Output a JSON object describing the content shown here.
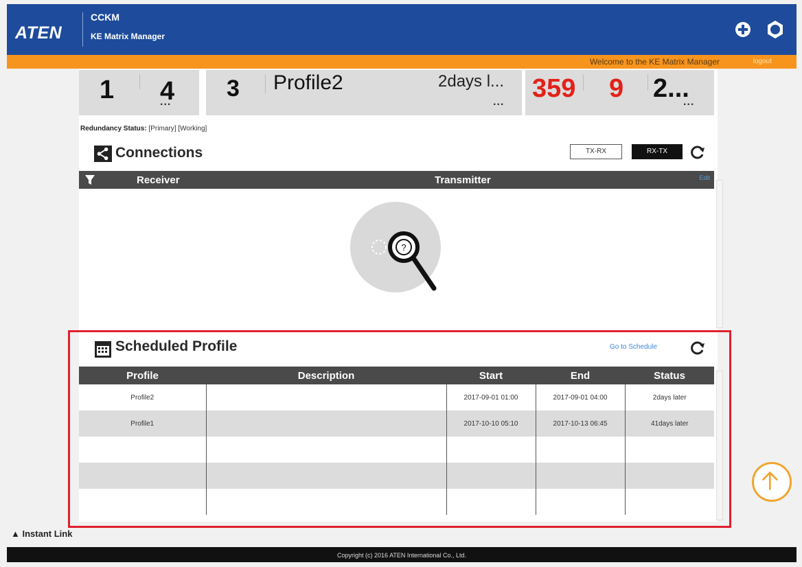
{
  "header": {
    "logo": "ATEN",
    "app_name": "CCKM",
    "app_subtitle": "KE Matrix Manager",
    "welcome": "Welcome to the KE Matrix Manager",
    "logout": "logout"
  },
  "stats": {
    "group1": {
      "a": "1",
      "b": "4"
    },
    "group2": {
      "a": "3",
      "profile": "Profile2",
      "time": "2days l..."
    },
    "group3": {
      "a": "359",
      "b": "9",
      "c": "2..."
    },
    "more": "..."
  },
  "redundancy": {
    "label": "Redundancy Status:",
    "value": "[Primary] [Working]"
  },
  "connections": {
    "title": "Connections",
    "btn_txrx": "TX-RX",
    "btn_rxtx": "RX-TX",
    "col_receiver": "Receiver",
    "col_transmitter": "Transmitter",
    "edit": "Edit"
  },
  "scheduled": {
    "title": "Scheduled Profile",
    "goto": "Go to Schedule",
    "columns": [
      "Profile",
      "Description",
      "Start",
      "End",
      "Status"
    ],
    "rows": [
      {
        "profile": "Profile2",
        "description": "",
        "start": "2017-09-01 01:00",
        "end": "2017-09-01 04:00",
        "status": "2days later"
      },
      {
        "profile": "Profile1",
        "description": "",
        "start": "2017-10-10 05:10",
        "end": "2017-10-13 06:45",
        "status": "41days later"
      }
    ]
  },
  "instant_link": "Instant Link",
  "footer": "Copyright (c) 2016 ATEN International Co., Ltd.",
  "colors": {
    "header_blue": "#1e4b9b",
    "accent_orange": "#f7941e",
    "highlight_red": "#e0202e",
    "stat_red": "#e32119"
  }
}
